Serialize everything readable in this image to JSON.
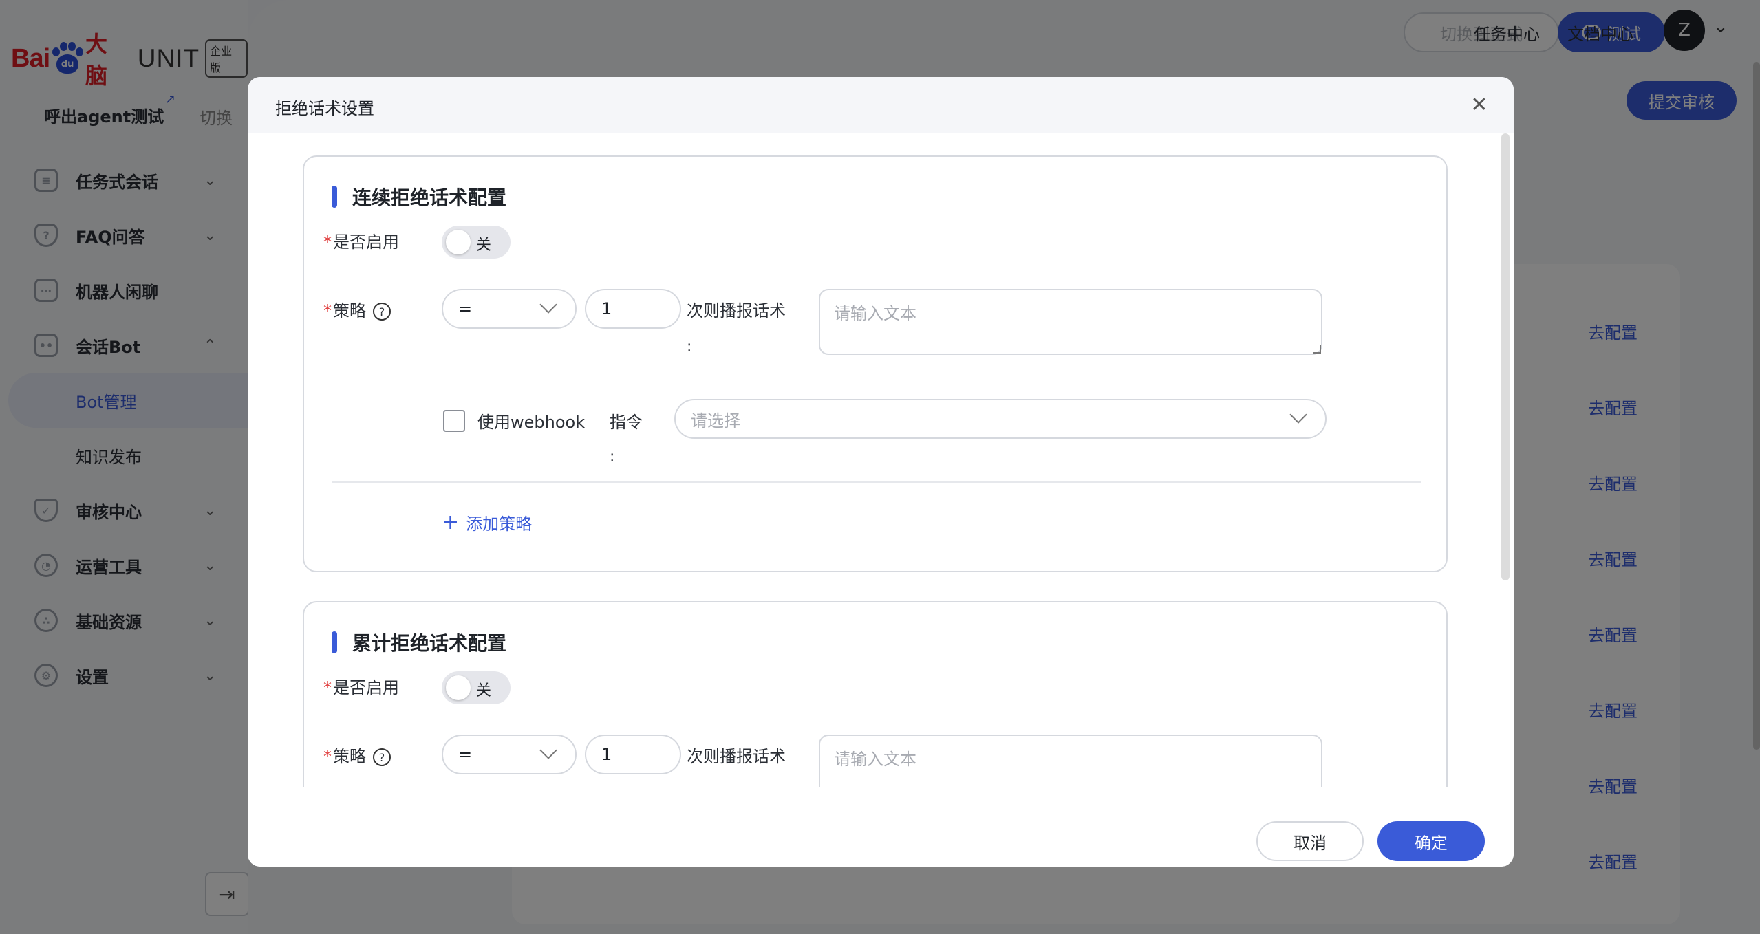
{
  "brand": {
    "bai": "Bai",
    "du": "du",
    "da": "大脑",
    "unit": "UNIT",
    "edition": "企业版"
  },
  "bot": {
    "name": "呼出agent测试",
    "switch_label": "切换"
  },
  "sidebar": {
    "items": [
      {
        "label": "任务式会话",
        "icon": "flow-icon"
      },
      {
        "label": "FAQ问答",
        "icon": "question-icon"
      },
      {
        "label": "机器人闲聊",
        "icon": "chat-icon"
      },
      {
        "label": "会话Bot",
        "icon": "bot-icon"
      },
      {
        "label": "Bot管理"
      },
      {
        "label": "知识发布"
      },
      {
        "label": "审核中心",
        "icon": "shield-icon"
      },
      {
        "label": "运营工具",
        "icon": "tool-icon"
      },
      {
        "label": "基础资源",
        "icon": "resource-icon"
      },
      {
        "label": "设置",
        "icon": "gear-icon"
      }
    ]
  },
  "header": {
    "switch_prod": "切换到正式",
    "test": "测试",
    "task_center": "任务中心",
    "doc_center": "文档中心",
    "avatar_initial": "Z",
    "submit_review": "提交审核"
  },
  "table": {
    "config_link": "去配置"
  },
  "modal": {
    "title": "拒绝话术设置",
    "sections": [
      {
        "title": "连续拒绝话术配置",
        "enable_label": "是否启用",
        "toggle_text": "关",
        "strategy_label": "策略",
        "operator": "=",
        "count": "1",
        "suffix_label": "次则播报话术",
        "colon": ":",
        "text_placeholder": "请输入文本",
        "webhook_label": "使用webhook",
        "command_label": "指令",
        "command_placeholder": "请选择",
        "add_strategy": "添加策略"
      },
      {
        "title": "累计拒绝话术配置",
        "enable_label": "是否启用",
        "toggle_text": "关",
        "strategy_label": "策略",
        "operator": "=",
        "count": "1",
        "suffix_label": "次则播报话术",
        "text_placeholder": "请输入文本"
      }
    ],
    "cancel": "取消",
    "ok": "确定"
  },
  "colors": {
    "accent": "#3a5bd8",
    "required": "#e03b3b"
  }
}
